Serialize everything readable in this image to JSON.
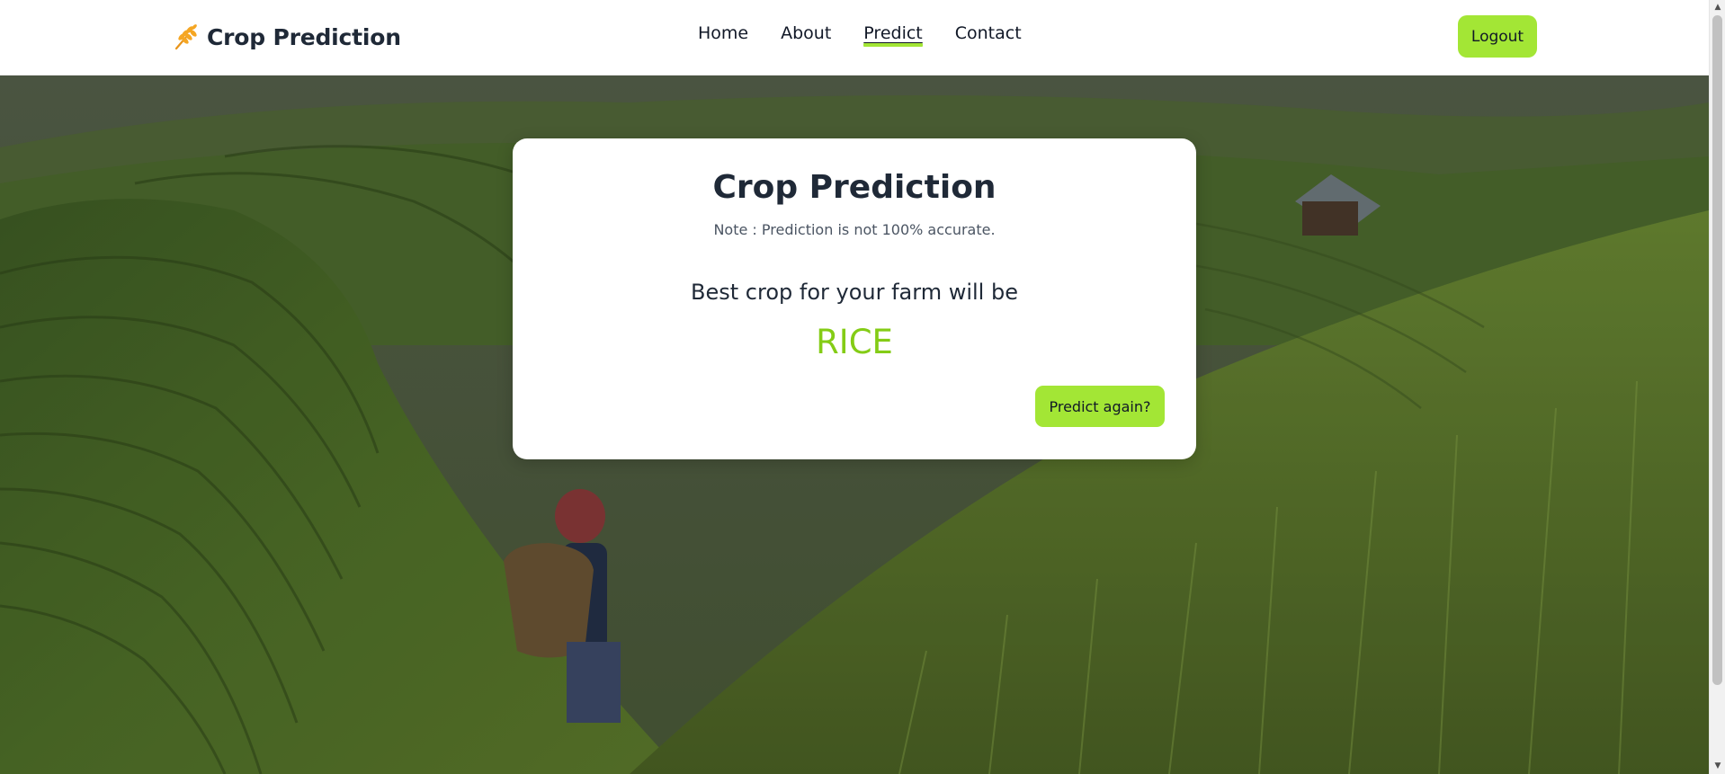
{
  "brand": {
    "name": "Crop Prediction",
    "icon": "wheat-icon"
  },
  "nav": {
    "items": [
      {
        "label": "Home"
      },
      {
        "label": "About"
      },
      {
        "label": "Predict",
        "active": true
      },
      {
        "label": "Contact"
      }
    ],
    "logout_label": "Logout"
  },
  "card": {
    "title": "Crop Prediction",
    "note": "Note : Prediction is not 100% accurate.",
    "subtitle": "Best crop for your farm will be",
    "result": "RICE",
    "predict_again_label": "Predict again?"
  },
  "colors": {
    "accent": "#a3e635",
    "result_text": "#84cc16",
    "heading": "#1f2937"
  },
  "scrollbar": {
    "up_icon": "arrow-up-icon",
    "down_icon": "arrow-down-icon"
  }
}
